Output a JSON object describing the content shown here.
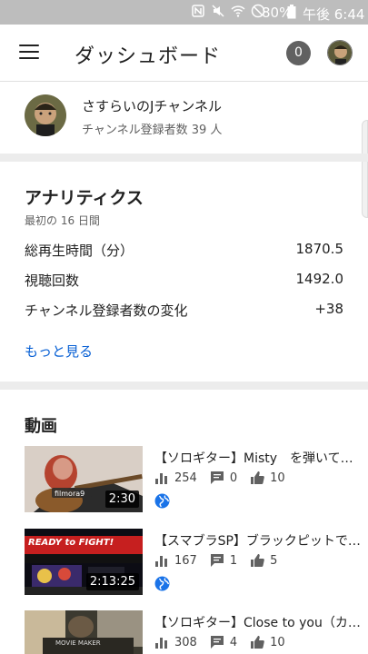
{
  "status_bar": {
    "battery": "80%",
    "time": "午後 6:44"
  },
  "app_bar": {
    "title": "ダッシュボード",
    "notification_count": "0"
  },
  "channel": {
    "name": "さすらいのJチャンネル",
    "subscribers": "チャンネル登録者数 39 人"
  },
  "analytics": {
    "title": "アナリティクス",
    "period": "最初の 16 日間",
    "metrics": [
      {
        "label": "総再生時間（分）",
        "value": "1870.5"
      },
      {
        "label": "視聴回数",
        "value": "1492.0"
      },
      {
        "label": "チャンネル登録者数の変化",
        "value": "+38"
      }
    ],
    "more_label": "もっと見る"
  },
  "videos": {
    "title": "動画",
    "items": [
      {
        "title": "【ソロギター】Misty　を弾いてみた",
        "duration": "2:30",
        "views": "254",
        "comments": "0",
        "likes": "10",
        "thumb_text": "filmora9"
      },
      {
        "title": "【スマブラSP】ブラックピットで勝つ",
        "duration": "2:13:25",
        "views": "167",
        "comments": "1",
        "likes": "5",
        "thumb_text": "READY to FIGHT!"
      },
      {
        "title": "【ソロギター】Close to you（カーペンターズ）",
        "duration": "",
        "views": "308",
        "comments": "4",
        "likes": "10",
        "thumb_text": "MOVIE MAKER"
      }
    ]
  }
}
